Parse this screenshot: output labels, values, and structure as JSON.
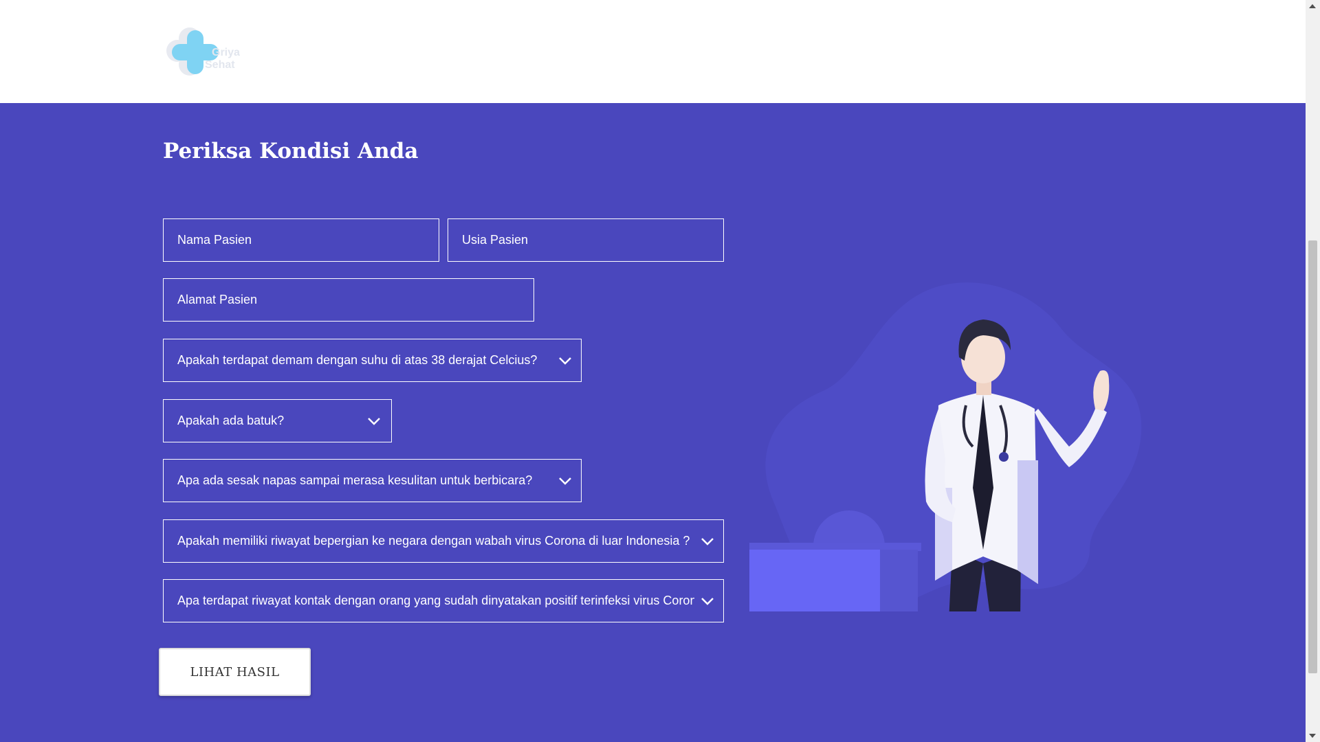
{
  "brand": {
    "name_line1": "Griya",
    "name_line2": "Sehat",
    "colors": {
      "logo_blue": "#7fd3f3",
      "logo_grey": "#e5e8ef"
    }
  },
  "page": {
    "title": "Periksa Kondisi Anda",
    "background": "#4a47bd"
  },
  "form": {
    "name_placeholder": "Nama Pasien",
    "age_placeholder": "Usia Pasien",
    "address_placeholder": "Alamat Pasien",
    "questions": [
      "Apakah terdapat demam dengan suhu di atas 38 derajat Celcius?",
      "Apakah ada batuk?",
      "Apa ada sesak napas sampai merasa kesulitan untuk berbicara?",
      "Apakah memiliki riwayat bepergian ke negara dengan wabah virus Corona di luar Indonesia ?",
      "Apa terdapat riwayat kontak dengan orang yang sudah dinyatakan positif terinfeksi virus Corona ?"
    ],
    "submit_label": "LIHAT HASIL"
  },
  "icons": {
    "dropdown": "chevron-down-icon",
    "logo": "cross-logo-icon",
    "illustration": "doctor-illustration"
  }
}
